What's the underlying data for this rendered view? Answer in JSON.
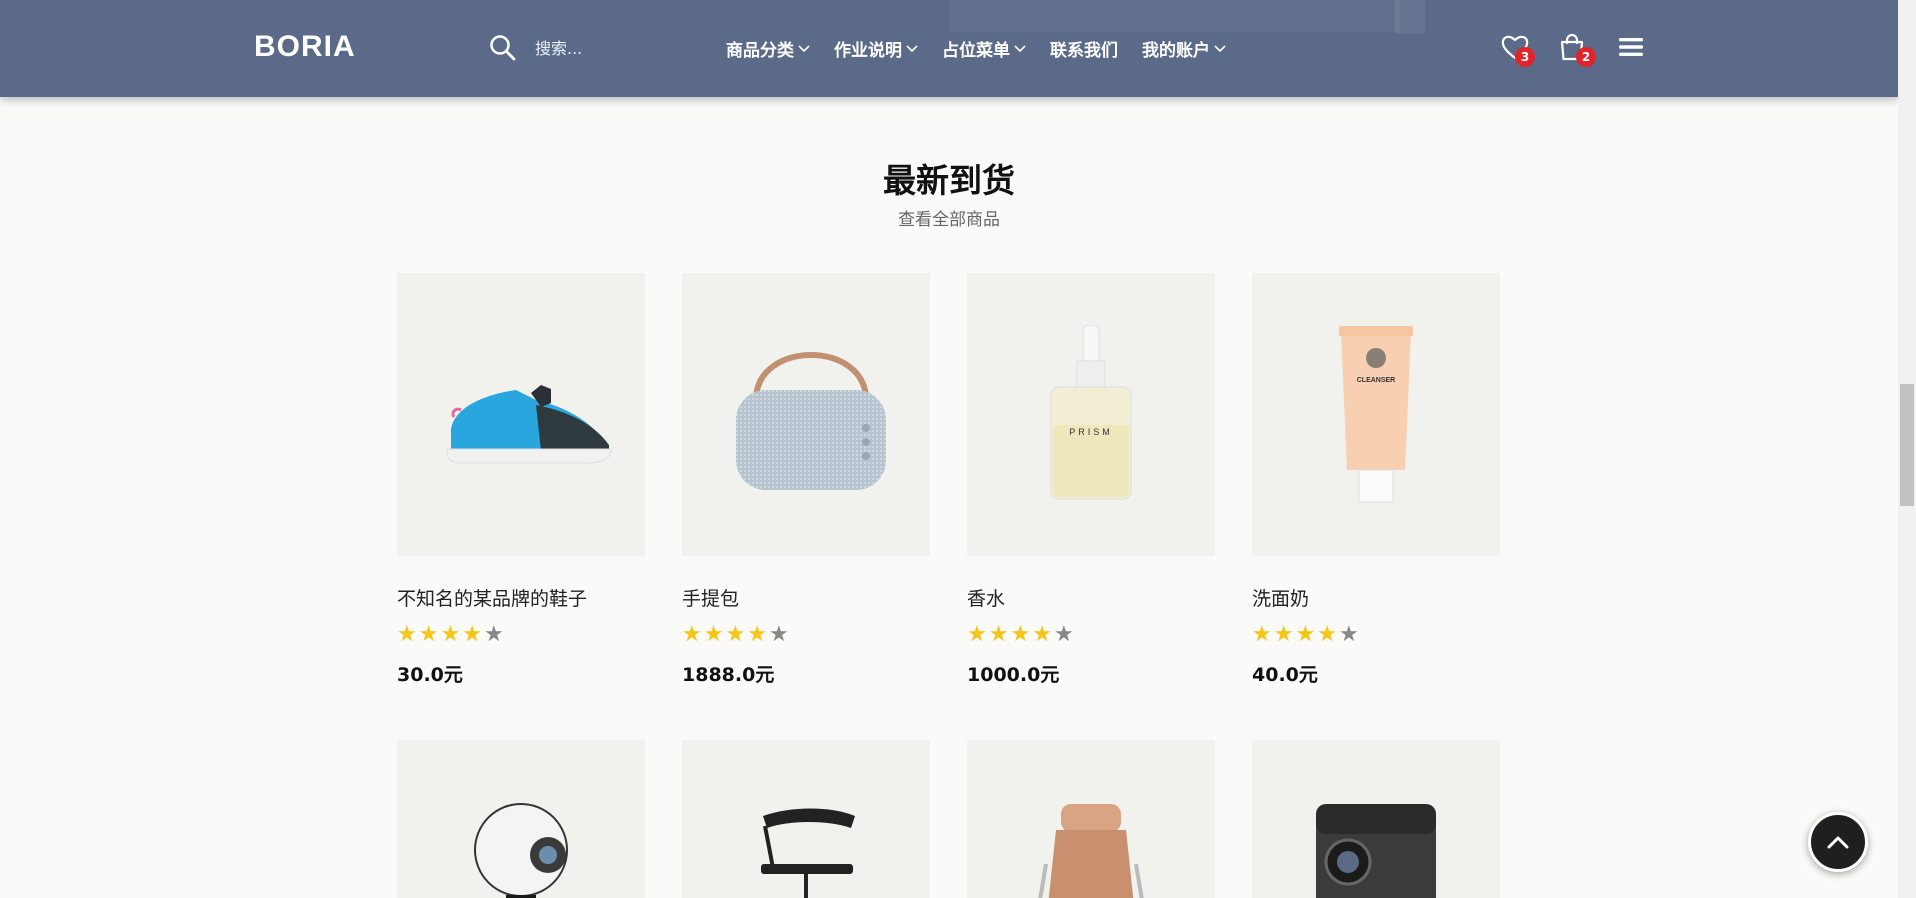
{
  "header": {
    "logo": "BORIA",
    "search_placeholder": "搜索...",
    "nav": [
      {
        "label": "商品分类",
        "dropdown": true
      },
      {
        "label": "作业说明",
        "dropdown": true
      },
      {
        "label": "占位菜单",
        "dropdown": true
      },
      {
        "label": "联系我们",
        "dropdown": false
      },
      {
        "label": "我的账户",
        "dropdown": true
      }
    ],
    "wishlist_count": "3",
    "cart_count": "2",
    "icons": [
      "search-icon",
      "heart-icon",
      "cart-icon",
      "menu-icon",
      "chevron-down-icon"
    ]
  },
  "section": {
    "title": "最新到货",
    "link": "查看全部商品"
  },
  "products": [
    {
      "name": "不知名的某品牌的鞋子",
      "rating": 4,
      "max_rating": 5,
      "price": "30.0元"
    },
    {
      "name": "手提包",
      "rating": 4,
      "max_rating": 5,
      "price": "1888.0元"
    },
    {
      "name": "香水",
      "rating": 4,
      "max_rating": 5,
      "price": "1000.0元"
    },
    {
      "name": "洗面奶",
      "rating": 4,
      "max_rating": 5,
      "price": "40.0元"
    }
  ],
  "product_images": {
    "perfume_label": "PRISM",
    "cleanser_label": "CLEANSER"
  },
  "colors": {
    "header_bg": "#5a6a88",
    "badge": "#e2232a",
    "star_on": "#f5c518",
    "star_off": "#888888"
  }
}
